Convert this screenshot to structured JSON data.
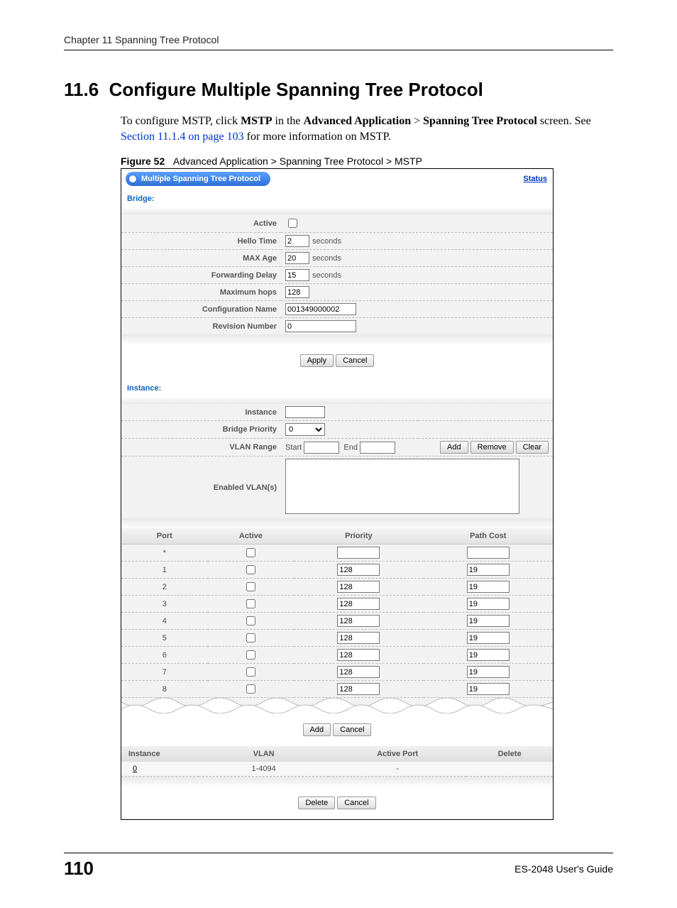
{
  "header": {
    "chapter": "Chapter 11 Spanning Tree Protocol"
  },
  "section": {
    "number": "11.6",
    "title": "Configure Multiple Spanning Tree Protocol",
    "intro_pre": "To configure MSTP, click ",
    "intro_bold1": "MSTP",
    "intro_mid1": " in the ",
    "intro_bold2": "Advanced Application",
    "intro_gt": " > ",
    "intro_bold3": "Spanning Tree Protocol",
    "intro_post1": " screen. See ",
    "intro_link": "Section 11.1.4 on page 103",
    "intro_post2": " for more information on MSTP."
  },
  "figure": {
    "label": "Figure 52",
    "caption": "Advanced Application > Spanning Tree Protocol > MSTP"
  },
  "ui": {
    "title": "Multiple Spanning Tree Protocol",
    "status_link": "Status",
    "bridge_label": "Bridge:",
    "fields": {
      "active": "Active",
      "hello_time": "Hello Time",
      "max_age": "MAX Age",
      "fwd_delay": "Forwarding Delay",
      "max_hops": "Maximum hops",
      "cfg_name": "Configuration Name",
      "rev_num": "Revision Number"
    },
    "values": {
      "hello_time": "2",
      "max_age": "20",
      "fwd_delay": "15",
      "max_hops": "128",
      "cfg_name": "001349000002",
      "rev_num": "0"
    },
    "units": {
      "seconds": "seconds"
    },
    "buttons": {
      "apply": "Apply",
      "cancel": "Cancel",
      "add": "Add",
      "remove": "Remove",
      "clear": "Clear",
      "delete": "Delete"
    },
    "instance_label": "Instance:",
    "instance_fields": {
      "instance": "Instance",
      "bridge_priority": "Bridge Priority",
      "vlan_range": "VLAN Range",
      "enabled_vlans": "Enabled VLAN(s)"
    },
    "instance_values": {
      "bridge_priority": "0",
      "vlan_start_label": "Start",
      "vlan_end_label": "End"
    },
    "ports": {
      "headers": {
        "port": "Port",
        "active": "Active",
        "priority": "Priority",
        "path_cost": "Path Cost"
      },
      "rows": [
        {
          "port": "*",
          "priority": "",
          "cost": ""
        },
        {
          "port": "1",
          "priority": "128",
          "cost": "19"
        },
        {
          "port": "2",
          "priority": "128",
          "cost": "19"
        },
        {
          "port": "3",
          "priority": "128",
          "cost": "19"
        },
        {
          "port": "4",
          "priority": "128",
          "cost": "19"
        },
        {
          "port": "5",
          "priority": "128",
          "cost": "19"
        },
        {
          "port": "6",
          "priority": "128",
          "cost": "19"
        },
        {
          "port": "7",
          "priority": "128",
          "cost": "19"
        },
        {
          "port": "8",
          "priority": "128",
          "cost": "19"
        }
      ]
    },
    "instance_table": {
      "headers": {
        "instance": "Instance",
        "vlan": "VLAN",
        "active_port": "Active Port",
        "delete": "Delete"
      },
      "row": {
        "instance": "0",
        "vlan": "1-4094",
        "active_port": "-"
      }
    }
  },
  "footer": {
    "page": "110",
    "guide": "ES-2048 User's Guide"
  }
}
